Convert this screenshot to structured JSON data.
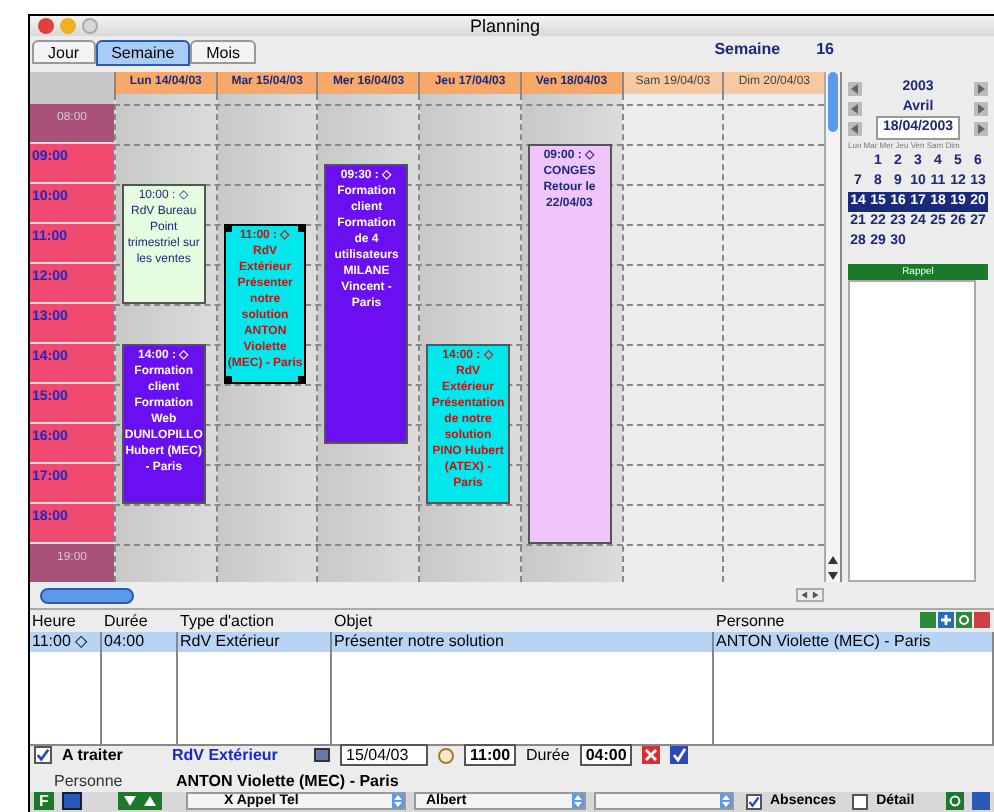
{
  "window": {
    "title": "Planning"
  },
  "tabs": [
    {
      "label": "Jour",
      "selected": false
    },
    {
      "label": "Semaine",
      "selected": true
    },
    {
      "label": "Mois",
      "selected": false
    }
  ],
  "week": {
    "label": "Semaine",
    "number": "16"
  },
  "days": [
    {
      "label": "Lun 14/04/03",
      "weekend": false
    },
    {
      "label": "Mar 15/04/03",
      "weekend": false
    },
    {
      "label": "Mer 16/04/03",
      "weekend": false
    },
    {
      "label": "Jeu 17/04/03",
      "weekend": false
    },
    {
      "label": "Ven 18/04/03",
      "weekend": false
    },
    {
      "label": "Sam 19/04/03",
      "weekend": true
    },
    {
      "label": "Dim 20/04/03",
      "weekend": true
    }
  ],
  "hours": [
    {
      "label": "08:00",
      "off": true
    },
    {
      "label": "09:00",
      "off": false
    },
    {
      "label": "10:00",
      "off": false
    },
    {
      "label": "11:00",
      "off": false
    },
    {
      "label": "12:00",
      "off": false
    },
    {
      "label": "13:00",
      "off": false
    },
    {
      "label": "14:00",
      "off": false
    },
    {
      "label": "15:00",
      "off": false
    },
    {
      "label": "16:00",
      "off": false
    },
    {
      "label": "17:00",
      "off": false
    },
    {
      "label": "18:00",
      "off": false
    },
    {
      "label": "19:00",
      "off": true
    }
  ],
  "events": [
    {
      "kind": "bureau",
      "color": "#e6fce0",
      "selected": false,
      "time": "10:00 : ◇",
      "title": "RdV Bureau",
      "text": "Point trimestriel sur les ventes"
    },
    {
      "kind": "exterieur",
      "color": "#00e8ec",
      "selected": true,
      "time": "11:00 : ◇",
      "title": "RdV Extérieur",
      "text": "Présenter notre solution ANTON Violette (MEC) - Paris"
    },
    {
      "kind": "formation",
      "color": "#6a10f0",
      "selected": false,
      "time": "09:30 : ◇",
      "title": "Formation client",
      "text": "Formation de 4 utilisateurs MILANE Vincent - Paris"
    },
    {
      "kind": "formation",
      "color": "#6a10f0",
      "selected": false,
      "time": "14:00 : ◇",
      "title": "Formation client",
      "text": "Formation Web DUNLOPILLO Hubert (MEC) - Paris"
    },
    {
      "kind": "exterieur",
      "color": "#00e8ec",
      "selected": false,
      "time": "14:00 : ◇",
      "title": "RdV Extérieur",
      "text": "Présentation de notre solution PINO Hubert (ATEX) - Paris"
    },
    {
      "kind": "conges",
      "color": "#f0c4fc",
      "selected": false,
      "time": "09:00 : ◇",
      "title": "CONGES",
      "text": "Retour le 22/04/03"
    }
  ],
  "mini_calendar": {
    "year": "2003",
    "month": "Avril",
    "date": "18/04/2003",
    "weekdays": "Lun Mar Mer Jeu Ven Sam Dim",
    "weeks": [
      {
        "days": [
          "1",
          "2",
          "3",
          "4",
          "5",
          "6"
        ],
        "selected": false
      },
      {
        "days": [
          "7",
          "8",
          "9",
          "10",
          "11",
          "12",
          "13"
        ],
        "selected": false
      },
      {
        "days": [
          "14",
          "15",
          "16",
          "17",
          "18",
          "19",
          "20"
        ],
        "selected": true
      },
      {
        "days": [
          "21",
          "22",
          "23",
          "24",
          "25",
          "26",
          "27"
        ],
        "selected": false
      },
      {
        "days": [
          "28",
          "29",
          "30"
        ],
        "selected": false
      }
    ]
  },
  "reminder": {
    "title": "Rappel"
  },
  "list": {
    "columns": [
      "Heure",
      "Durée",
      "Type d'action",
      "Objet",
      "Personne"
    ],
    "rows": [
      {
        "cells": [
          "11:00 ◇",
          "04:00",
          "RdV Extérieur",
          "Présenter notre solution",
          "ANTON Violette (MEC) - Paris"
        ],
        "selected": true
      }
    ]
  },
  "form": {
    "to_do": {
      "label": "A traiter",
      "checked": true
    },
    "type": "RdV Extérieur",
    "date": "15/04/03",
    "time": "11:00",
    "duration_label": "Durée",
    "duration": "04:00",
    "person_label": "Personne",
    "person": "ANTON Violette (MEC) - Paris"
  },
  "toolbar": {
    "letter": "F",
    "call_type": "X Appel Tel",
    "user": "Albert",
    "absences": {
      "label": "Absences",
      "checked": true
    },
    "detail": {
      "label": "Détail",
      "checked": false
    }
  }
}
